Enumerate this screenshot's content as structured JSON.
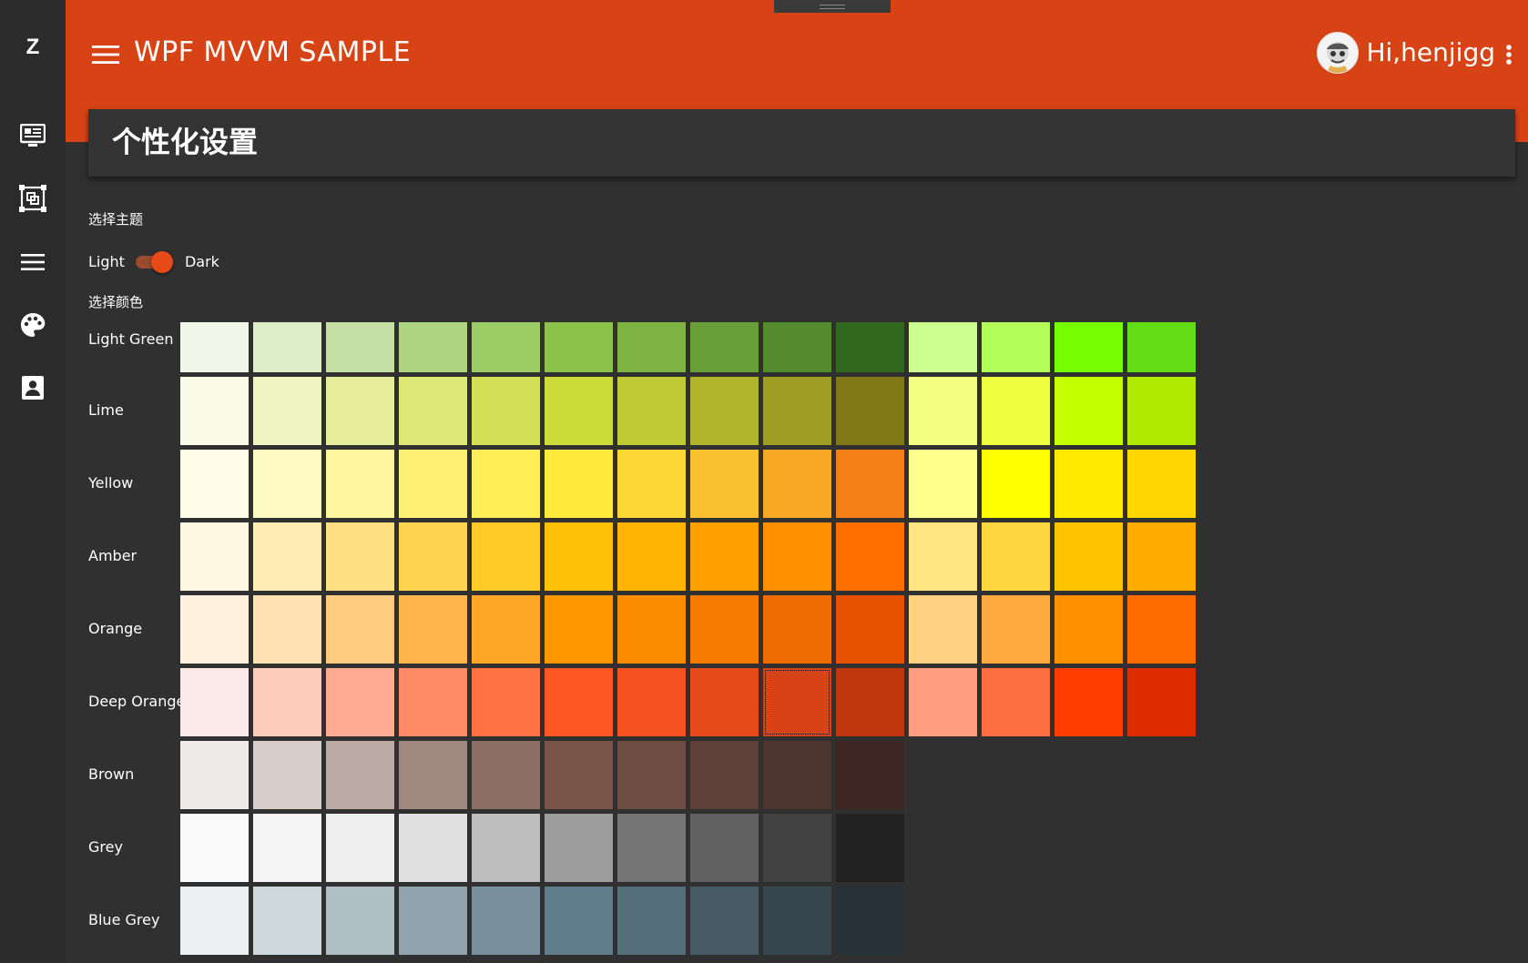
{
  "sidebar": {
    "logo": "Z",
    "items": [
      {
        "icon": "dashboard-monitor-icon"
      },
      {
        "icon": "layers-frame-icon"
      },
      {
        "icon": "list-menu-icon"
      },
      {
        "icon": "palette-icon"
      },
      {
        "icon": "contact-card-icon"
      }
    ]
  },
  "header": {
    "title": "WPF MVVM SAMPLE",
    "user_greeting": "Hi,henjigg",
    "accent": "#d84315"
  },
  "page": {
    "title": "个性化设置",
    "theme_section_label": "选择主题",
    "theme_light_label": "Light",
    "theme_dark_label": "Dark",
    "theme_is_dark": true,
    "color_section_label": "选择颜色"
  },
  "palette": {
    "selected": {
      "row": "Deep Orange",
      "index": 8
    },
    "rows": [
      {
        "name": "Light Green",
        "colors": [
          "#F1F8E9",
          "#DCEDC8",
          "#C5E1A5",
          "#AED581",
          "#9CCC65",
          "#8BC34A",
          "#7CB342",
          "#689F38",
          "#558B2F",
          "#33691E",
          "#CCFF90",
          "#B2FF59",
          "#76FF03",
          "#64DD17"
        ]
      },
      {
        "name": "Lime",
        "colors": [
          "#F9FBE7",
          "#F0F4C3",
          "#E6EE9C",
          "#DCE775",
          "#D4E157",
          "#CDDC39",
          "#C0CA33",
          "#AFB42B",
          "#9E9D24",
          "#827717",
          "#F4FF81",
          "#EEFF41",
          "#C6FF00",
          "#AEEA00"
        ]
      },
      {
        "name": "Yellow",
        "colors": [
          "#FFFDE7",
          "#FFF9C4",
          "#FFF59D",
          "#FFF176",
          "#FFEE58",
          "#FFEB3B",
          "#FDD835",
          "#FBC02D",
          "#F9A825",
          "#F57F17",
          "#FFFF8D",
          "#FFFF00",
          "#FFEA00",
          "#FFD600"
        ]
      },
      {
        "name": "Amber",
        "colors": [
          "#FFF8E1",
          "#FFECB3",
          "#FFE082",
          "#FFD54F",
          "#FFCA28",
          "#FFC107",
          "#FFB300",
          "#FFA000",
          "#FF8F00",
          "#FF6F00",
          "#FFE57F",
          "#FFD740",
          "#FFC400",
          "#FFAB00"
        ]
      },
      {
        "name": "Orange",
        "colors": [
          "#FFF3E0",
          "#FFE0B2",
          "#FFCC80",
          "#FFB74D",
          "#FFA726",
          "#FF9800",
          "#FB8C00",
          "#F57C00",
          "#EF6C00",
          "#E65100",
          "#FFD180",
          "#FFAB40",
          "#FF9100",
          "#FF6D00"
        ]
      },
      {
        "name": "Deep Orange",
        "colors": [
          "#FBE9E7",
          "#FFCCBC",
          "#FFAB91",
          "#FF8A65",
          "#FF7043",
          "#FF5722",
          "#F4511E",
          "#E64A19",
          "#D84315",
          "#BF360C",
          "#FF9E80",
          "#FF6E40",
          "#FF3D00",
          "#DD2C00"
        ]
      },
      {
        "name": "Brown",
        "colors": [
          "#EFEBE9",
          "#D7CCC8",
          "#BCAAA4",
          "#A1887F",
          "#8D6E63",
          "#795548",
          "#6D4C41",
          "#5D4037",
          "#4E342E",
          "#3E2723"
        ]
      },
      {
        "name": "Grey",
        "colors": [
          "#FAFAFA",
          "#F5F5F5",
          "#EEEEEE",
          "#E0E0E0",
          "#BDBDBD",
          "#9E9E9E",
          "#757575",
          "#616161",
          "#424242",
          "#212121"
        ]
      },
      {
        "name": "Blue Grey",
        "colors": [
          "#ECEFF1",
          "#CFD8DC",
          "#B0BEC5",
          "#90A4AE",
          "#78909C",
          "#607D8B",
          "#546E7A",
          "#455A64",
          "#37474F",
          "#263238"
        ]
      }
    ]
  }
}
